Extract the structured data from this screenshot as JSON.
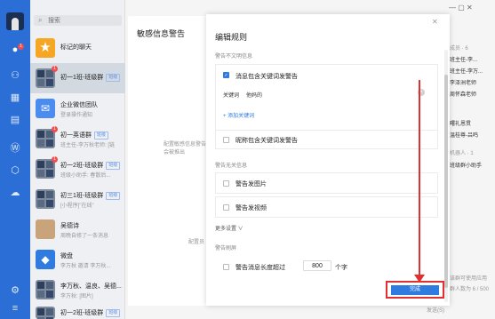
{
  "search": {
    "placeholder": "搜索"
  },
  "chats": [
    {
      "name": "标记的聊天",
      "tag": "",
      "snippet": "",
      "avatar": "star"
    },
    {
      "name": "初一1班-班级群",
      "tag": "班级",
      "snippet": "",
      "avatar": "grid",
      "badge": "1"
    },
    {
      "name": "企业微信团队",
      "tag": "",
      "snippet": "登录操作通知",
      "avatar": "blue"
    },
    {
      "name": "初一英语群",
      "tag": "班级",
      "snippet": "班主任-李万秋老师: [链",
      "avatar": "grid",
      "badge": "1"
    },
    {
      "name": "初一2班-班级群",
      "tag": "班级",
      "snippet": "班级小助手: 春散后...",
      "avatar": "grid",
      "badge": "1"
    },
    {
      "name": "初三1班-班级群",
      "tag": "班级",
      "snippet": "[小程序]\"在线\"",
      "avatar": "grid"
    },
    {
      "name": "吴德诗",
      "tag": "",
      "snippet": "周晚自修了一条消息",
      "avatar": "person"
    },
    {
      "name": "微盘",
      "tag": "",
      "snippet": "李万秋 邀请 李万秋...",
      "avatar": "cloud"
    },
    {
      "name": "李万秋、温良、吴德...",
      "tag": "",
      "snippet": "李万秋: [图片]",
      "avatar": "grid"
    },
    {
      "name": "初一2班-班级群",
      "tag": "班级",
      "snippet": "",
      "avatar": "grid"
    }
  ],
  "drawer": {
    "title": "敏感信息警告",
    "desc": "配置敏感信息警告，将会被推出",
    "desc2": "配置员"
  },
  "modal": {
    "title": "编辑规则",
    "section1": "警告不文明信息",
    "keyword_checkbox": "消息包含关键词发警告",
    "keyword_label": "关键词",
    "keyword_value": "他妈的",
    "add_keyword": "+ 添加关键词",
    "nickname_checkbox": "昵称包含关键词发警告",
    "section2": "警告无关信息",
    "image_checkbox": "警告发图片",
    "video_checkbox": "警告发视频",
    "more_settings": "更多设置 ∨",
    "section3": "警告刷屏",
    "length_checkbox": "警告消息长度超过",
    "length_value": "800",
    "length_unit": "个字",
    "done_button": "完成"
  },
  "right": {
    "header": "成员 · 6",
    "members": [
      "班主任-李...",
      "班主任-李万...",
      "李泽洲老师",
      "周怀森老师",
      "曙礼恩贯",
      "温桂尊-吕鸣"
    ],
    "bots_header": "机器人 · 1",
    "bot": "班级群小助手",
    "hint": "该群可使用应用",
    "hint2": "群人数为 6 / 500",
    "send": "发送(S)"
  },
  "colors": {
    "accent": "#2f7be0",
    "rail": "#2b6fd6",
    "highlight": "#e03030"
  }
}
